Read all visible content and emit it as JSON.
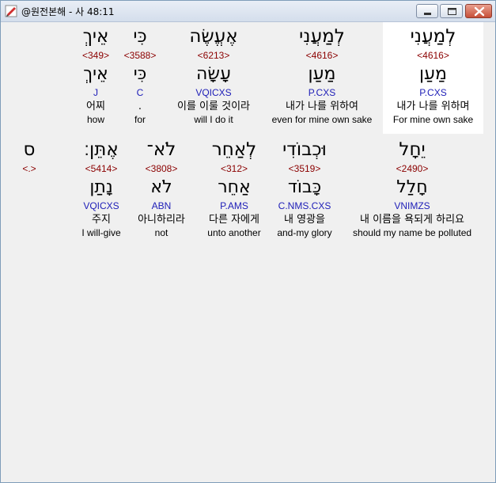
{
  "window": {
    "title": "@원전본해 - 사 48:11"
  },
  "rows": [
    {
      "words": [
        {
          "hebrew": "אֵיךְ",
          "strong": "<349>",
          "root": "אֵיךְ",
          "parse": "J",
          "korean": "어찌",
          "english": "how"
        },
        {
          "hebrew": "כִּי",
          "strong": "<3588>",
          "root": "כִּי",
          "parse": "C",
          "korean": ".",
          "english": "for"
        },
        {
          "hebrew": "אֶעֱשֶׂה",
          "strong": "<6213>",
          "root": "עָשָׂה",
          "parse": "VQICXS",
          "korean": "이를 이룰 것이라",
          "english": "will I do it"
        },
        {
          "hebrew": "לְמַעֲנִי",
          "strong": "<4616>",
          "root": "מַעַן",
          "parse": "P.CXS",
          "korean": "내가 나를 위하여",
          "english": "even for mine own sake"
        },
        {
          "hebrew": "לְמַעֲנִי",
          "strong": "<4616>",
          "root": "מַעַן",
          "parse": "P.CXS",
          "korean": "내가 나를 위하며",
          "english": "For mine own sake"
        }
      ]
    },
    {
      "words": [
        {
          "hebrew": "ס",
          "strong": "<.>",
          "root": "",
          "parse": "",
          "korean": "",
          "english": ""
        },
        {
          "hebrew": "אֶתֵּן׃",
          "strong": "<5414>",
          "root": "נָתַן",
          "parse": "VQICXS",
          "korean": "주지",
          "english": "I will-give"
        },
        {
          "hebrew": "לֹא־",
          "strong": "<3808>",
          "root": "לֹא",
          "parse": "ABN",
          "korean": "아니하리라",
          "english": "not"
        },
        {
          "hebrew": "לְאַחֵר",
          "strong": "<312>",
          "root": "אַחֵר",
          "parse": "P.AMS",
          "korean": "다른 자에게",
          "english": "unto another"
        },
        {
          "hebrew": "וּכְבוֹדִי",
          "strong": "<3519>",
          "root": "כָּבוֹד",
          "parse": "C.NMS.CXS",
          "korean": "내 영광을",
          "english": "and-my glory"
        },
        {
          "hebrew": "יֵחָל",
          "strong": "<2490>",
          "root": "חָלַל",
          "parse": "VNIMZS",
          "korean": "내 이름을 욕되게 하리요",
          "english": "should my name be polluted"
        }
      ]
    }
  ]
}
